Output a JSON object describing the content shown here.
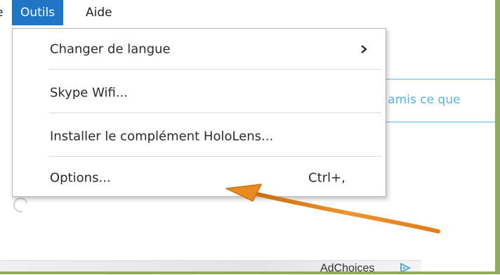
{
  "menubar": {
    "partial_label": "e",
    "outils_label": "Outils",
    "aide_label": "Aide"
  },
  "dropdown": {
    "items": [
      {
        "label": "Changer de langue",
        "shortcut": "",
        "submenu": true
      },
      {
        "label": "Skype Wifi...",
        "shortcut": "",
        "submenu": false
      },
      {
        "label": "Installer le complément HoloLens...",
        "shortcut": "",
        "submenu": false
      },
      {
        "label": "Options...",
        "shortcut": "Ctrl+,",
        "submenu": false
      }
    ]
  },
  "background": {
    "input_text": "s amis ce que",
    "ad_text": "AdChoices"
  },
  "colors": {
    "menu_highlight": "#1f76c6",
    "annotation_arrow": "#e88a1e",
    "frame_green": "#8fac5c",
    "input_accent": "#65b6df"
  }
}
